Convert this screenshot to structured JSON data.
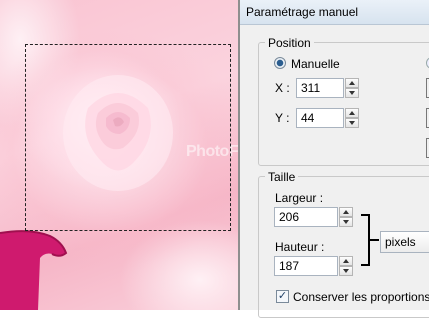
{
  "dialog": {
    "title": "Paramétrage manuel",
    "position": {
      "group_label": "Position",
      "mode_label": "Manuelle",
      "x_label": "X :",
      "x_value": "311",
      "y_label": "Y :",
      "y_value": "44"
    },
    "size": {
      "group_label": "Taille",
      "width_label": "Largeur :",
      "width_value": "206",
      "height_label": "Hauteur :",
      "height_value": "187",
      "unit_selected": "pixels",
      "keep_proportions_label": "Conserver les proportions",
      "keep_proportions_checked": true
    }
  },
  "canvas": {
    "watermark": "PhotoFiltreGraphic"
  }
}
